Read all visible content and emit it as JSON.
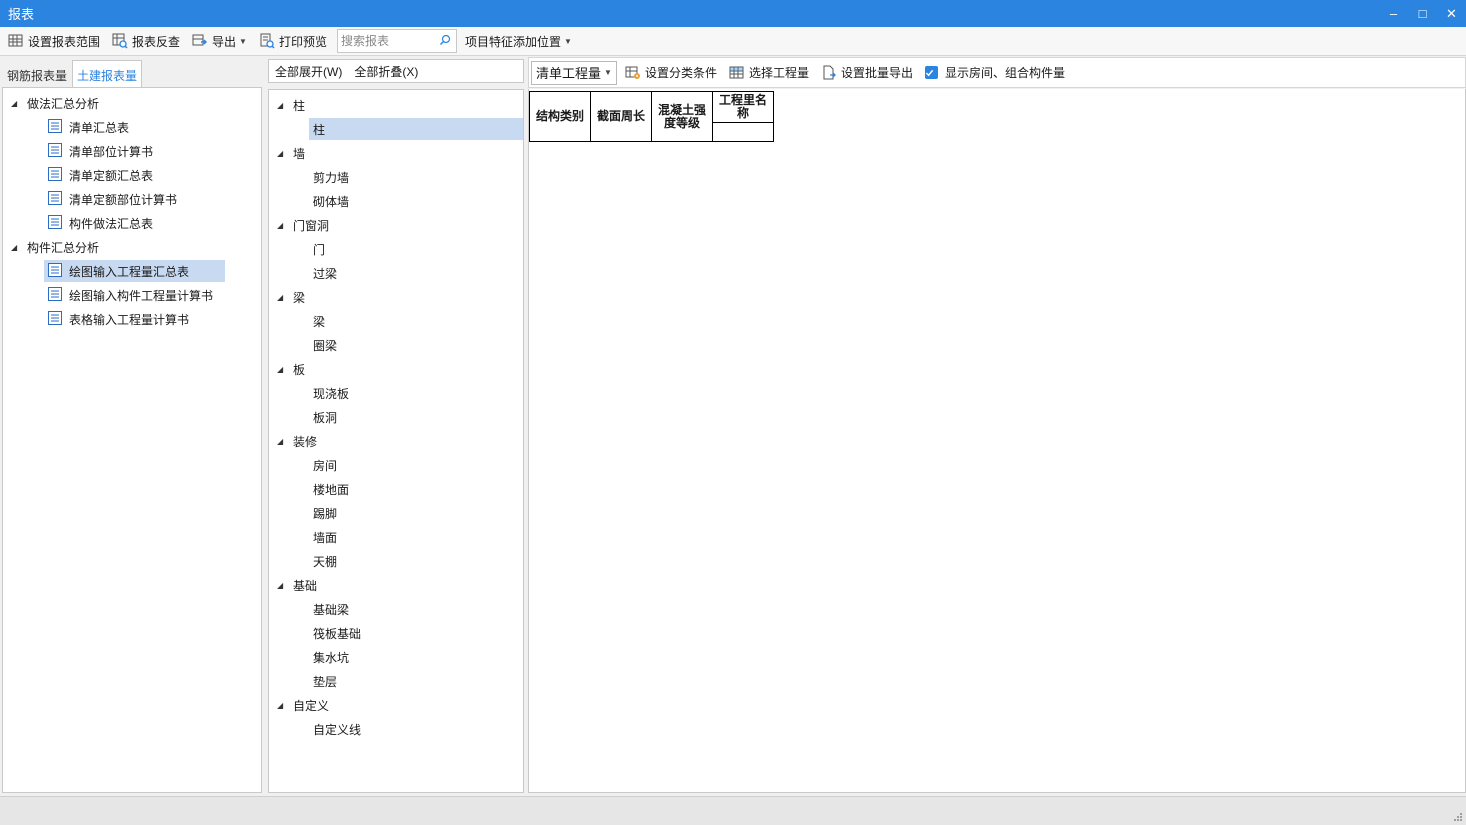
{
  "window": {
    "title": "报表",
    "buttons": {
      "minimize": "–",
      "maximize": "□",
      "close": "✕"
    }
  },
  "toolbar": {
    "set_range": "设置报表范围",
    "reverse_check": "报表反查",
    "export": "导出",
    "print_preview": "打印预览",
    "search_placeholder": "搜索报表",
    "feature_position": "项目特征添加位置"
  },
  "left_tabs": [
    {
      "label": "钢筋报表量",
      "active": false
    },
    {
      "label": "土建报表量",
      "active": true
    }
  ],
  "report_tree": {
    "groups": [
      {
        "label": "做法汇总分析",
        "items": [
          "清单汇总表",
          "清单部位计算书",
          "清单定额汇总表",
          "清单定额部位计算书",
          "构件做法汇总表"
        ]
      },
      {
        "label": "构件汇总分析",
        "items": [
          "绘图输入工程量汇总表",
          "绘图输入构件工程量计算书",
          "表格输入工程量计算书"
        ]
      }
    ],
    "selected": "绘图输入工程量汇总表"
  },
  "middle": {
    "expand_all": "全部展开(W)",
    "collapse_all": "全部折叠(X)",
    "tree": [
      {
        "label": "柱",
        "children": [
          "柱"
        ]
      },
      {
        "label": "墙",
        "children": [
          "剪力墙",
          "砌体墙"
        ]
      },
      {
        "label": "门窗洞",
        "children": [
          "门",
          "过梁"
        ]
      },
      {
        "label": "梁",
        "children": [
          "梁",
          "圈梁"
        ]
      },
      {
        "label": "板",
        "children": [
          "现浇板",
          "板洞"
        ]
      },
      {
        "label": "装修",
        "children": [
          "房间",
          "楼地面",
          "踢脚",
          "墙面",
          "天棚"
        ]
      },
      {
        "label": "基础",
        "children": [
          "基础梁",
          "筏板基础",
          "集水坑",
          "垫层"
        ]
      },
      {
        "label": "自定义",
        "children": [
          "自定义线"
        ]
      }
    ],
    "selected": "柱"
  },
  "right_toolbar": {
    "quantity_select": "清单工程量",
    "set_classify": "设置分类条件",
    "select_quantity": "选择工程量",
    "batch_export": "设置批量导出",
    "show_room_label": "显示房间、组合构件量",
    "show_room_checked": true
  },
  "report_table": {
    "headers": [
      "结构类别",
      "截面周长",
      "混凝土强度等级",
      "工程里名称"
    ]
  },
  "colors": {
    "accent": "#2b84e0",
    "selection": "#c8daf1"
  }
}
